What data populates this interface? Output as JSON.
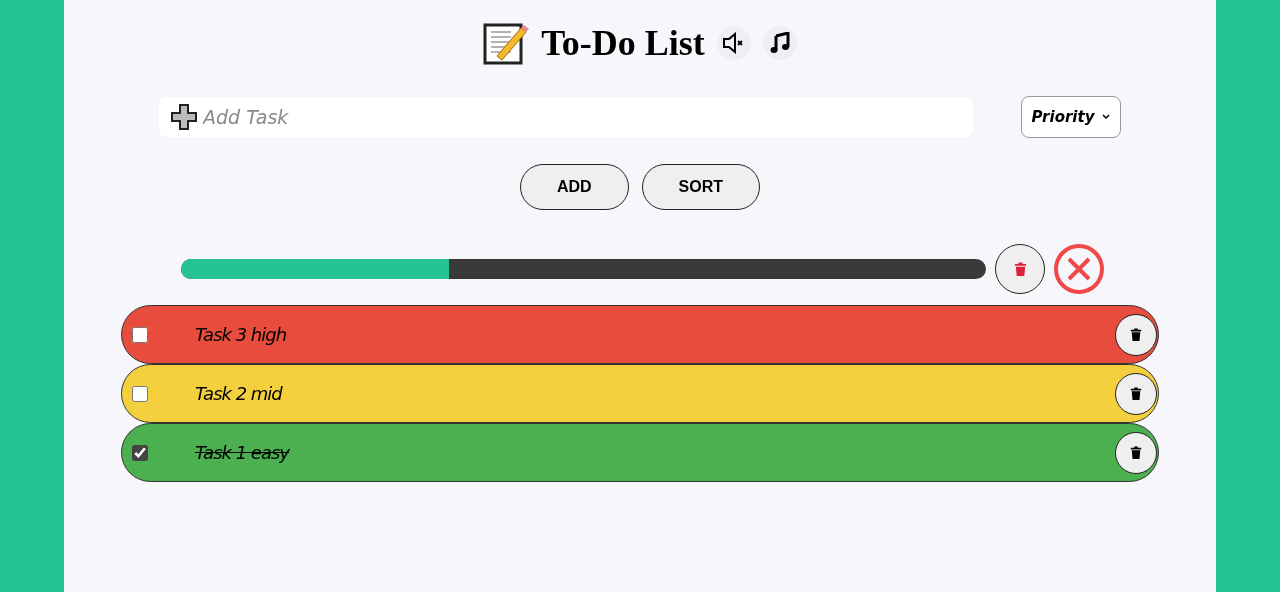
{
  "title": "To-Do List",
  "task_input": {
    "placeholder": "Add Task"
  },
  "priority_select": {
    "value": "Priority"
  },
  "buttons": [
    "ADD",
    "SORT"
  ],
  "progress": {
    "level": 0.333
  },
  "tasks": [
    {
      "text": "Task 3 high",
      "checked": false,
      "color": "#e74c3c"
    },
    {
      "text": "Task 2 mid",
      "checked": false,
      "color": "#f4d03f"
    },
    {
      "text": "Task 1 easy",
      "checked": true,
      "color": "#4caf50"
    }
  ]
}
